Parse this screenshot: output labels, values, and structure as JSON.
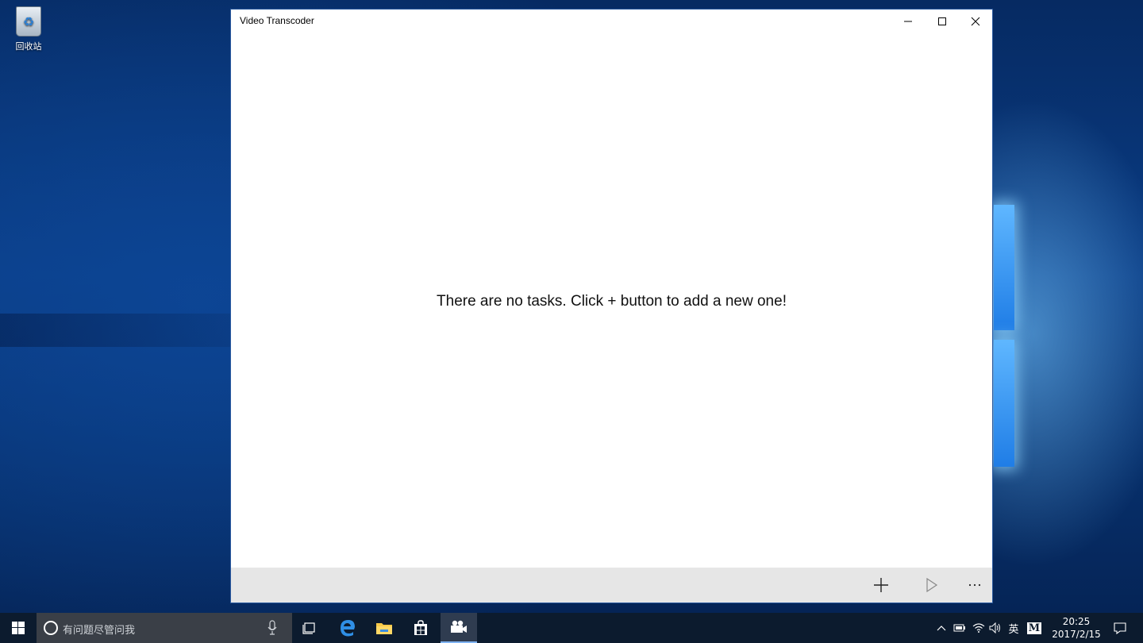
{
  "desktop": {
    "recycle_bin_label": "回收站"
  },
  "window": {
    "title": "Video Transcoder",
    "empty_message": "There are no tasks. Click + button to add a new one!",
    "caption_buttons": [
      "minimize-icon",
      "maximize-icon",
      "close-icon"
    ],
    "command_bar": [
      "add-icon",
      "play-icon",
      "more-icon"
    ]
  },
  "taskbar": {
    "search_placeholder": "有问题尽管问我",
    "pinned": [
      "task-view-icon",
      "edge-icon",
      "file-explorer-icon",
      "store-icon",
      "video-transcoder-icon"
    ],
    "tray": {
      "language": "英",
      "ime": "M",
      "time": "20:25",
      "date": "2017/2/15"
    }
  },
  "colors": {
    "taskbar_bg": "#0c1b2e",
    "command_bar_bg": "#e6e6e6",
    "window_bg": "#ffffff",
    "accent": "#0078d7"
  }
}
